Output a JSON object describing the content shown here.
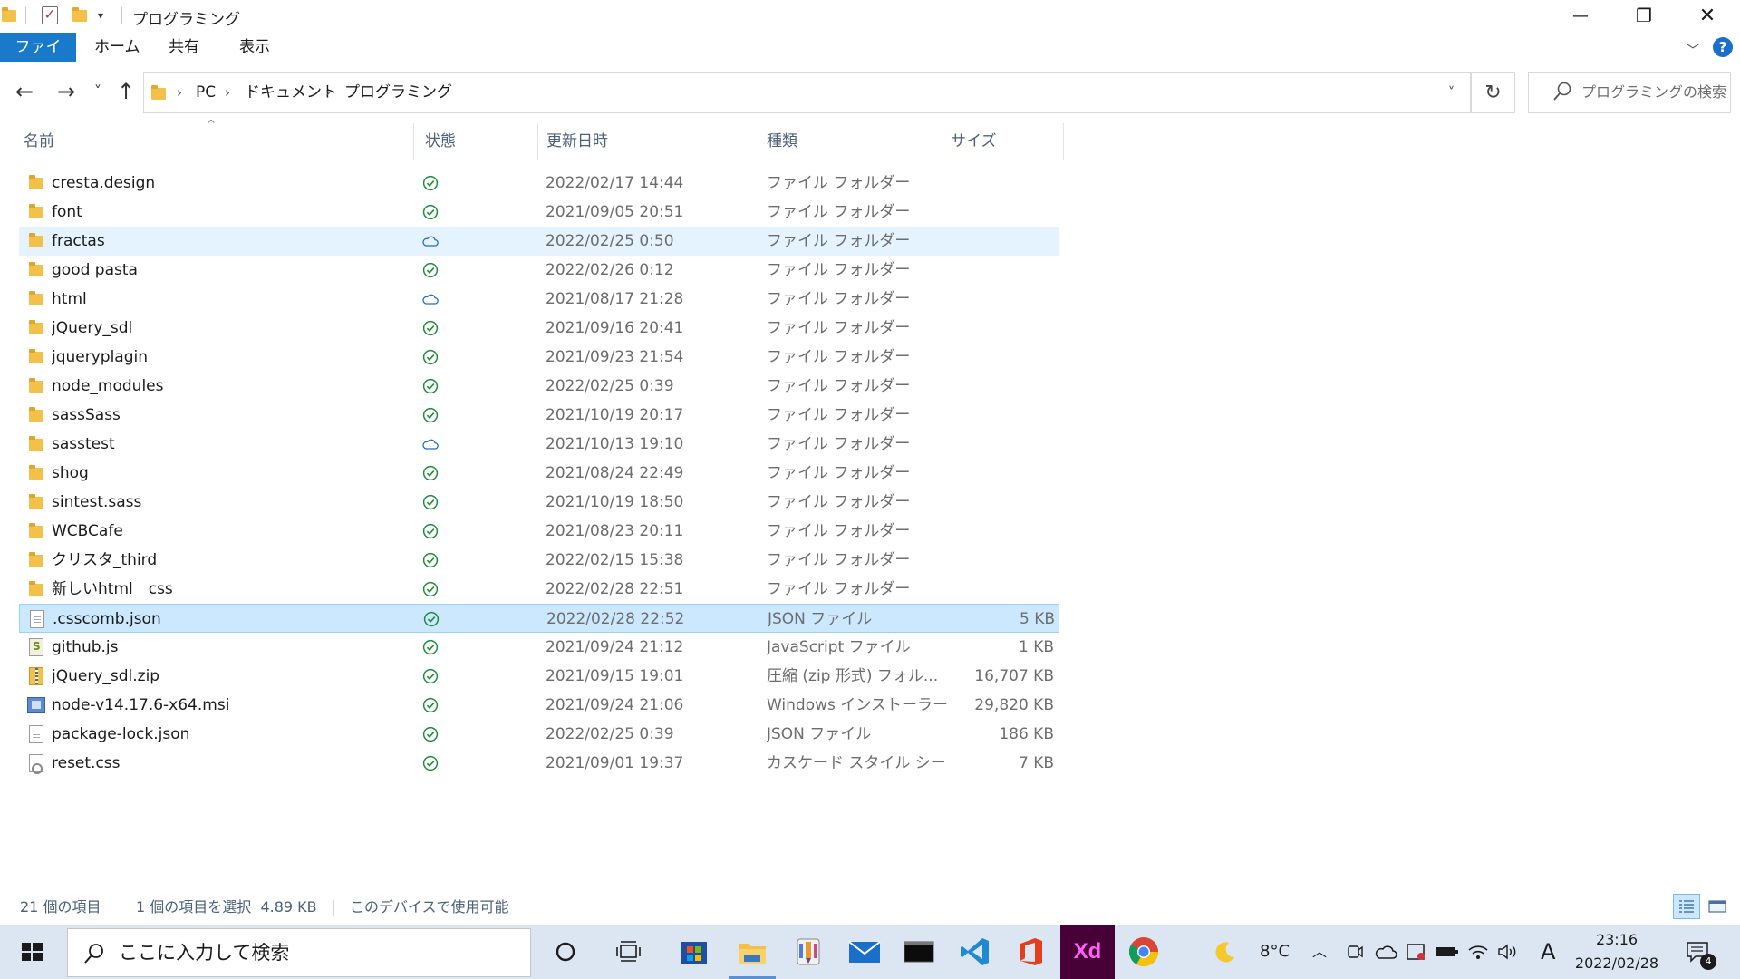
{
  "window": {
    "title": "プログラミング",
    "quick_access_dropdown": "▾",
    "controls": {
      "minimize": "—",
      "maximize": "❐",
      "close": "✕"
    }
  },
  "ribbon": {
    "tabs": [
      {
        "label": "ファイル"
      },
      {
        "label": "ホーム"
      },
      {
        "label": "共有"
      },
      {
        "label": "表示"
      }
    ],
    "collapse": "﹀",
    "help": "?"
  },
  "nav": {
    "back": "←",
    "forward": "→",
    "recent": "˅",
    "up": "↑"
  },
  "address": {
    "segments": [
      "PC",
      "ドキュメント",
      "プログラミング"
    ],
    "separator": "›",
    "dropdown": "˅",
    "refresh": "↻"
  },
  "search": {
    "placeholder": "プログラミングの検索"
  },
  "columns": {
    "name": "名前",
    "status": "状態",
    "modified": "更新日時",
    "type": "種類",
    "size": "サイズ",
    "sort_indicator": "^"
  },
  "files": [
    {
      "name": "cresta.design",
      "status": "synced",
      "modified": "2022/02/17 14:44",
      "type": "ファイル フォルダー",
      "size": "",
      "kind": "folder"
    },
    {
      "name": "font",
      "status": "synced",
      "modified": "2021/09/05 20:51",
      "type": "ファイル フォルダー",
      "size": "",
      "kind": "folder"
    },
    {
      "name": "fractas",
      "status": "cloud",
      "modified": "2022/02/25 0:50",
      "type": "ファイル フォルダー",
      "size": "",
      "kind": "folder"
    },
    {
      "name": "good pasta",
      "status": "synced",
      "modified": "2022/02/26 0:12",
      "type": "ファイル フォルダー",
      "size": "",
      "kind": "folder"
    },
    {
      "name": "html",
      "status": "cloud",
      "modified": "2021/08/17 21:28",
      "type": "ファイル フォルダー",
      "size": "",
      "kind": "folder"
    },
    {
      "name": "jQuery_sdl",
      "status": "synced",
      "modified": "2021/09/16 20:41",
      "type": "ファイル フォルダー",
      "size": "",
      "kind": "folder"
    },
    {
      "name": "jqueryplagin",
      "status": "synced",
      "modified": "2021/09/23 21:54",
      "type": "ファイル フォルダー",
      "size": "",
      "kind": "folder"
    },
    {
      "name": "node_modules",
      "status": "synced",
      "modified": "2022/02/25 0:39",
      "type": "ファイル フォルダー",
      "size": "",
      "kind": "folder"
    },
    {
      "name": "sassSass",
      "status": "synced",
      "modified": "2021/10/19 20:17",
      "type": "ファイル フォルダー",
      "size": "",
      "kind": "folder"
    },
    {
      "name": "sasstest",
      "status": "cloud",
      "modified": "2021/10/13 19:10",
      "type": "ファイル フォルダー",
      "size": "",
      "kind": "folder"
    },
    {
      "name": "shog",
      "status": "synced",
      "modified": "2021/08/24 22:49",
      "type": "ファイル フォルダー",
      "size": "",
      "kind": "folder"
    },
    {
      "name": "sintest.sass",
      "status": "synced",
      "modified": "2021/10/19 18:50",
      "type": "ファイル フォルダー",
      "size": "",
      "kind": "folder"
    },
    {
      "name": "WCBCafe",
      "status": "synced",
      "modified": "2021/08/23 20:11",
      "type": "ファイル フォルダー",
      "size": "",
      "kind": "folder"
    },
    {
      "name": "クリスタ_third",
      "status": "synced",
      "modified": "2022/02/15 15:38",
      "type": "ファイル フォルダー",
      "size": "",
      "kind": "folder"
    },
    {
      "name": "新しいhtml　css",
      "status": "synced",
      "modified": "2022/02/28 22:51",
      "type": "ファイル フォルダー",
      "size": "",
      "kind": "folder"
    },
    {
      "name": ".csscomb.json",
      "status": "synced",
      "modified": "2022/02/28 22:52",
      "type": "JSON ファイル",
      "size": "5 KB",
      "kind": "doc"
    },
    {
      "name": "github.js",
      "status": "synced",
      "modified": "2021/09/24 21:12",
      "type": "JavaScript ファイル",
      "size": "1 KB",
      "kind": "js"
    },
    {
      "name": "jQuery_sdl.zip",
      "status": "synced",
      "modified": "2021/09/15 19:01",
      "type": "圧縮 (zip 形式) フォル...",
      "size": "16,707 KB",
      "kind": "zip"
    },
    {
      "name": "node-v14.17.6-x64.msi",
      "status": "synced",
      "modified": "2021/09/24 21:06",
      "type": "Windows インストーラー...",
      "size": "29,820 KB",
      "kind": "msi"
    },
    {
      "name": "package-lock.json",
      "status": "synced",
      "modified": "2022/02/25 0:39",
      "type": "JSON ファイル",
      "size": "186 KB",
      "kind": "doc"
    },
    {
      "name": "reset.css",
      "status": "synced",
      "modified": "2021/09/01 19:37",
      "type": "カスケード スタイル シート...",
      "size": "7 KB",
      "kind": "css"
    }
  ],
  "statusbar": {
    "item_count": "21 個の項目",
    "selection": "1 個の項目を選択  4.89 KB",
    "availability": "このデバイスで使用可能"
  },
  "taskbar": {
    "search_placeholder": "ここに入力して検索",
    "weather": "8°C",
    "ime": "A",
    "time": "23:16",
    "date": "2022/02/28",
    "notification_count": "4",
    "apps": [
      "cortana-icon",
      "task-view-icon",
      "microsoft-store-icon",
      "file-explorer-icon",
      "paint-icon",
      "mail-icon",
      "terminal-icon",
      "vscode-icon",
      "office-icon",
      "adobe-xd-icon",
      "chrome-icon"
    ]
  },
  "colors": {
    "accent": "#1979ca",
    "selected_row": "#cce8ff",
    "hover_row": "#e5f3ff",
    "synced_green": "#1e8c3a",
    "cloud_blue": "#1f6fc5",
    "folder_yellow": "#f3c04a",
    "header_text": "#4c607a"
  }
}
